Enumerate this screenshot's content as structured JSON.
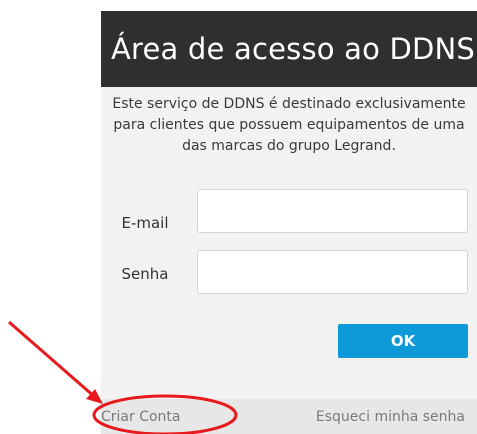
{
  "dialog": {
    "title": "Área de acesso ao DDNS",
    "notice_lines": [
      "Este serviço de DDNS é destinado exclusivamente",
      "para clientes que possuem equipamentos de uma",
      "das marcas do grupo Legrand."
    ]
  },
  "form": {
    "email_label": "E-mail",
    "email_value": "",
    "password_label": "Senha",
    "password_value": "",
    "submit_label": "OK"
  },
  "footer": {
    "create_account": "Criar Conta",
    "forgot_password": "Esqueci minha senha"
  },
  "colors": {
    "header_bg": "#2f2f2f",
    "panel_bg": "#f2f2f2",
    "footer_bg": "#e7e7e7",
    "button_bg": "#0e9ad9",
    "annotation": "#e8191c"
  }
}
